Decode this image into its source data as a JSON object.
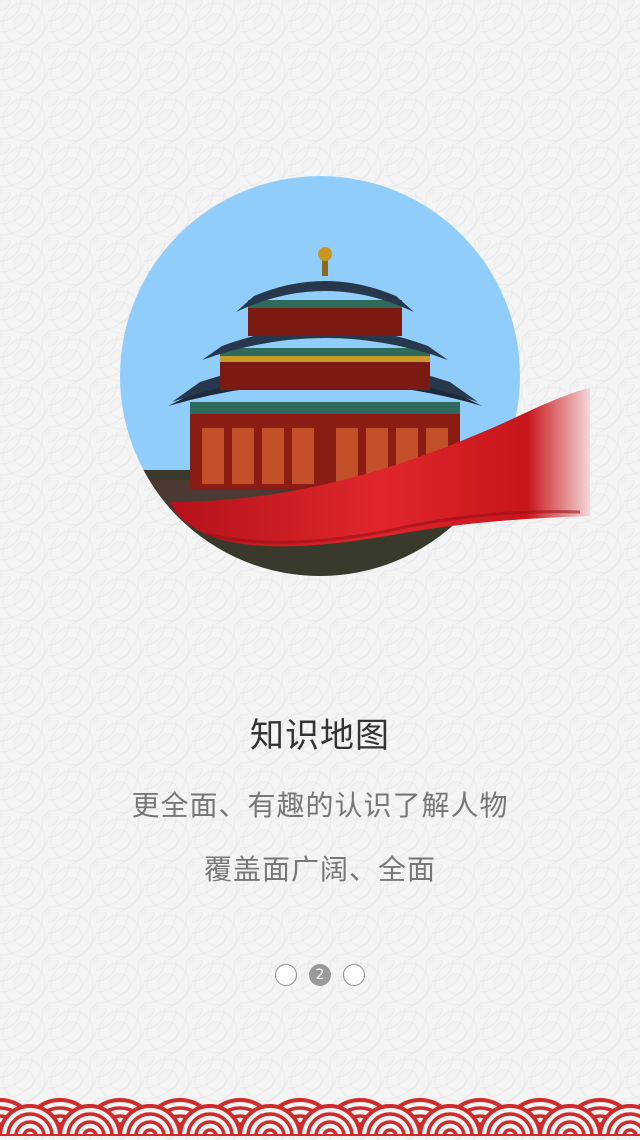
{
  "title": "知识地图",
  "subtitle_line1": "更全面、有趣的认识了解人物",
  "subtitle_line2": "覆盖面广阔、全面",
  "pager": {
    "total": 3,
    "current": 2,
    "current_label": "2"
  },
  "colors": {
    "sky": "#91cdfa",
    "ribbon": "#d4181e",
    "wave": "#d02a2a",
    "background": "#f4f4f4"
  }
}
